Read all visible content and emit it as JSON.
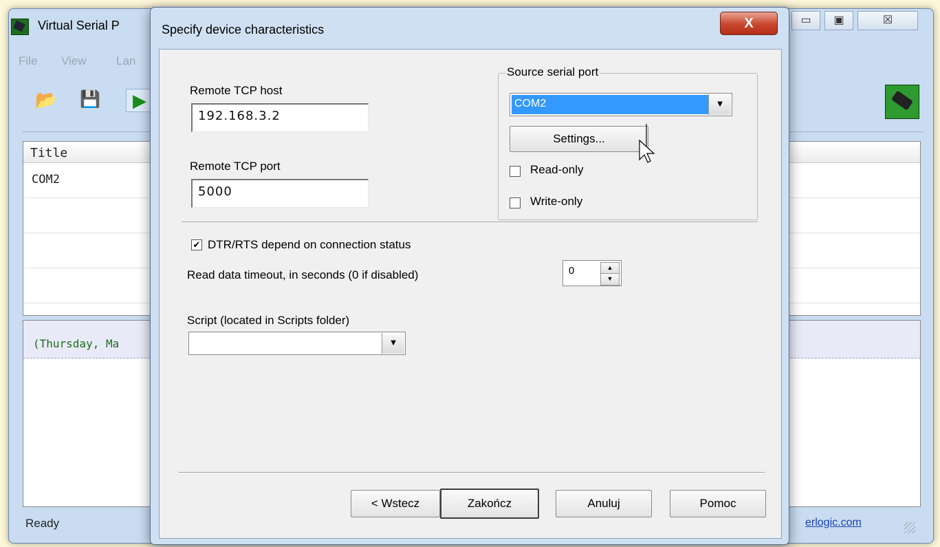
{
  "main_window": {
    "title": "Virtual Serial P",
    "controls": {
      "minimize": "▭",
      "maximize": "▣",
      "close": "☒"
    },
    "menu": [
      "File",
      "View",
      "Lan"
    ],
    "list": {
      "header": "Title",
      "rows": [
        "COM2"
      ]
    },
    "log_entry": "(Thursday, Ma",
    "status_text": "Ready",
    "status_link": "erlogic.com"
  },
  "dialog": {
    "title": "Specify device characteristics",
    "close_label": "X",
    "remote_host": {
      "label": "Remote TCP host",
      "value": "192.168.3.2"
    },
    "remote_port": {
      "label": "Remote TCP port",
      "value": "5000"
    },
    "source_port": {
      "legend": "Source serial port",
      "selected": "COM2",
      "settings_label": "Settings...",
      "read_only_label": "Read-only",
      "write_only_label": "Write-only"
    },
    "dtr_rts_label": "DTR/RTS depend on connection status",
    "dtr_rts_checked": true,
    "timeout": {
      "label": "Read data timeout, in seconds (0 if disabled)",
      "value": "0"
    },
    "script": {
      "label": "Script (located in Scripts folder)",
      "value": ""
    },
    "buttons": {
      "back": "< Wstecz",
      "finish": "Zakończ",
      "cancel": "Anuluj",
      "help": "Pomoc"
    }
  },
  "icons": [
    "app-icon",
    "open-folder-icon",
    "save-icon",
    "play-icon",
    "connector-icon",
    "dropdown-arrow-icon",
    "mouse-cursor-icon"
  ]
}
